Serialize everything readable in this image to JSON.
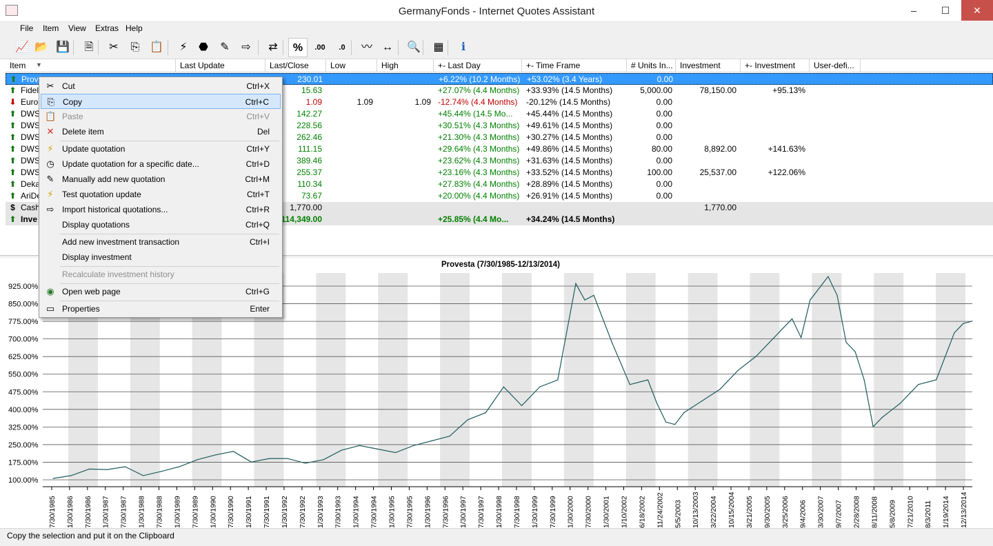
{
  "window": {
    "title": "GermanyFonds - Internet Quotes Assistant",
    "minimize": "–",
    "maximize": "☐",
    "close": "✕"
  },
  "menu": [
    "File",
    "Item",
    "View",
    "Extras",
    "Help"
  ],
  "toolbar": [
    {
      "name": "chart-icon",
      "glyph": "📈"
    },
    {
      "name": "open-folder-icon",
      "glyph": "📂"
    },
    {
      "name": "save-icon",
      "glyph": "💾"
    },
    {
      "name": "new-item-icon",
      "glyph": "🗎"
    },
    {
      "name": "cut-icon",
      "glyph": "✂"
    },
    {
      "name": "copy-icon",
      "glyph": "⎘"
    },
    {
      "name": "paste-icon",
      "glyph": "📋"
    },
    {
      "name": "update-icon",
      "glyph": "⚡"
    },
    {
      "name": "stop-icon",
      "glyph": "⬣"
    },
    {
      "name": "edit-icon",
      "glyph": "✎"
    },
    {
      "name": "import-icon",
      "glyph": "⇨"
    },
    {
      "name": "transfer-icon",
      "glyph": "⇄"
    },
    {
      "name": "percent-icon",
      "glyph": "%"
    },
    {
      "name": "more-decimals-icon",
      "glyph": ".00"
    },
    {
      "name": "less-decimals-icon",
      "glyph": ".0"
    },
    {
      "name": "compare-chart-icon",
      "glyph": "〰"
    },
    {
      "name": "timeframe-chart-icon",
      "glyph": "↔"
    },
    {
      "name": "search-icon",
      "glyph": "🔍"
    },
    {
      "name": "calculator-icon",
      "glyph": "▦"
    },
    {
      "name": "info-icon",
      "glyph": "ℹ"
    }
  ],
  "columns": [
    "Item",
    "Last Update",
    "Last/Close",
    "Low",
    "High",
    "+- Last Day",
    "+- Time Frame",
    "# Units In...",
    "Investment",
    "+- Investment",
    "User-defi..."
  ],
  "rows": [
    {
      "icon": "up",
      "item": "Prov",
      "update": "",
      "close": "230.01",
      "low": "",
      "high": "",
      "day": "+6.22% (10.2 Months)",
      "tf": "+53.02% (3.4 Years)",
      "units": "0.00",
      "inv": "",
      "invchg": "",
      "selected": true
    },
    {
      "icon": "up",
      "item": "Fidel",
      "update": "",
      "close": "15.63",
      "low": "",
      "high": "",
      "day": "+27.07% (4.4 Months)",
      "tf": "+33.93% (14.5 Months)",
      "units": "5,000.00",
      "inv": "78,150.00",
      "invchg": "+95.13%"
    },
    {
      "icon": "down",
      "item": "Euro",
      "update": "",
      "close": "1.09",
      "low": "1.09",
      "high": "1.09",
      "day": "-12.74% (4.4 Months)",
      "tf": "-20.12% (14.5 Months)",
      "units": "0.00",
      "inv": "",
      "invchg": ""
    },
    {
      "icon": "up",
      "item": "DWS",
      "update": "",
      "close": "142.27",
      "low": "",
      "high": "",
      "day": "+45.44% (14.5 Mo...",
      "tf": "+45.44% (14.5 Months)",
      "units": "0.00",
      "inv": "",
      "invchg": ""
    },
    {
      "icon": "up",
      "item": "DWS",
      "update": "",
      "close": "228.56",
      "low": "",
      "high": "",
      "day": "+30.51% (4.3 Months)",
      "tf": "+49.61% (14.5 Months)",
      "units": "0.00",
      "inv": "",
      "invchg": ""
    },
    {
      "icon": "up",
      "item": "DWS",
      "update": "",
      "close": "262.46",
      "low": "",
      "high": "",
      "day": "+21.30% (4.3 Months)",
      "tf": "+30.27% (14.5 Months)",
      "units": "0.00",
      "inv": "",
      "invchg": ""
    },
    {
      "icon": "up",
      "item": "DWS",
      "update": "",
      "close": "111.15",
      "low": "",
      "high": "",
      "day": "+29.64% (4.3 Months)",
      "tf": "+49.86% (14.5 Months)",
      "units": "80.00",
      "inv": "8,892.00",
      "invchg": "+141.63%"
    },
    {
      "icon": "up",
      "item": "DWS",
      "update": "",
      "close": "389.46",
      "low": "",
      "high": "",
      "day": "+23.62% (4.3 Months)",
      "tf": "+31.63% (14.5 Months)",
      "units": "0.00",
      "inv": "",
      "invchg": ""
    },
    {
      "icon": "up",
      "item": "DWS",
      "update": "",
      "close": "255.37",
      "low": "",
      "high": "",
      "day": "+23.16% (4.3 Months)",
      "tf": "+33.52% (14.5 Months)",
      "units": "100.00",
      "inv": "25,537.00",
      "invchg": "+122.06%"
    },
    {
      "icon": "up2",
      "item": "Deka",
      "update": "",
      "close": "110.34",
      "low": "",
      "high": "",
      "day": "+27.83% (4.4 Months)",
      "tf": "+28.89% (14.5 Months)",
      "units": "0.00",
      "inv": "",
      "invchg": ""
    },
    {
      "icon": "up2",
      "item": "AriDe",
      "update": "",
      "close": "73.67",
      "low": "",
      "high": "",
      "day": "+20.00% (4.4 Months)",
      "tf": "+26.91% (14.5 Months)",
      "units": "0.00",
      "inv": "",
      "invchg": ""
    },
    {
      "icon": "cash",
      "item": "Cash",
      "update": "",
      "close": "1,770.00",
      "low": "",
      "high": "",
      "day": "",
      "tf": "",
      "units": "",
      "inv": "1,770.00",
      "invchg": "",
      "gray": true
    },
    {
      "icon": "up",
      "item": "Inve",
      "update": "",
      "close": "114,349.00",
      "low": "",
      "high": "",
      "day": "+25.85% (4.4 Mo...",
      "tf": "+34.24% (14.5 Months)",
      "units": "",
      "inv": "",
      "invchg": "",
      "gray": true,
      "bold": true
    }
  ],
  "context_menu": [
    {
      "label": "Cut",
      "shortcut": "Ctrl+X",
      "icon": "cut-icon",
      "glyph": "✂"
    },
    {
      "label": "Copy",
      "shortcut": "Ctrl+C",
      "icon": "copy-icon",
      "glyph": "⎘",
      "highlight": true
    },
    {
      "label": "Paste",
      "shortcut": "Ctrl+V",
      "icon": "paste-icon",
      "glyph": "📋",
      "disabled": true
    },
    {
      "label": "Delete item",
      "shortcut": "Del",
      "icon": "delete-icon",
      "glyph": "✕"
    },
    {
      "sep": true
    },
    {
      "label": "Update quotation",
      "shortcut": "Ctrl+Y",
      "icon": "update-icon",
      "glyph": "⚡"
    },
    {
      "label": "Update quotation for a specific date...",
      "shortcut": "Ctrl+D",
      "icon": "clock-icon",
      "glyph": "◷"
    },
    {
      "label": "Manually add new quotation",
      "shortcut": "Ctrl+M",
      "icon": "edit-icon",
      "glyph": "✎"
    },
    {
      "label": "Test quotation update",
      "shortcut": "Ctrl+T",
      "icon": "test-icon",
      "glyph": "⚡"
    },
    {
      "label": "Import historical quotations...",
      "shortcut": "Ctrl+R",
      "icon": "import-icon",
      "glyph": "⇨"
    },
    {
      "label": "Display quotations",
      "shortcut": "Ctrl+Q",
      "icon": "",
      "glyph": ""
    },
    {
      "sep": true
    },
    {
      "label": "Add new investment transaction",
      "shortcut": "Ctrl+I",
      "icon": "",
      "glyph": ""
    },
    {
      "label": "Display investment",
      "shortcut": "",
      "icon": "",
      "glyph": ""
    },
    {
      "sep": true
    },
    {
      "label": "Recalculate investment history",
      "shortcut": "",
      "icon": "",
      "glyph": "",
      "disabled": true
    },
    {
      "sep": true
    },
    {
      "label": "Open web page",
      "shortcut": "Ctrl+G",
      "icon": "globe-icon",
      "glyph": "◉"
    },
    {
      "sep": true
    },
    {
      "label": "Properties",
      "shortcut": "Enter",
      "icon": "properties-icon",
      "glyph": "▭"
    }
  ],
  "status": "Copy the selection and put it on the Clipboard",
  "colors": {
    "line": "#1f5c5c",
    "band": "#e6e6e6",
    "selection": "#3399ff",
    "green": "#008000",
    "red": "#c00000"
  },
  "chart_data": {
    "type": "line",
    "title": "Provesta (7/30/1985-12/13/2014)",
    "yticks": [
      "100.00%",
      "175.00%",
      "250.00%",
      "325.00%",
      "400.00%",
      "475.00%",
      "550.00%",
      "625.00%",
      "700.00%",
      "775.00%",
      "850.00%",
      "925.00%"
    ],
    "ylim": [
      100,
      975
    ],
    "xticks": [
      "7/30/1985",
      "1/30/1986",
      "7/30/1986",
      "1/30/1987",
      "7/30/1987",
      "1/30/1988",
      "7/30/1988",
      "1/30/1989",
      "7/30/1989",
      "1/30/1990",
      "7/30/1990",
      "1/30/1991",
      "7/30/1991",
      "1/30/1992",
      "7/30/1992",
      "1/30/1993",
      "7/30/1993",
      "1/30/1994",
      "7/30/1994",
      "1/30/1995",
      "7/30/1995",
      "1/30/1996",
      "7/30/1996",
      "1/30/1997",
      "7/30/1997",
      "1/30/1998",
      "7/30/1998",
      "1/30/1999",
      "7/30/1999",
      "1/30/2000",
      "7/30/2000",
      "1/30/2001",
      "1/10/2002",
      "6/18/2002",
      "11/24/2002",
      "5/5/2003",
      "10/13/2003",
      "3/22/2004",
      "10/15/2004",
      "3/21/2005",
      "9/30/2005",
      "3/25/2006",
      "9/4/2006",
      "3/30/2007",
      "9/7/2007",
      "2/28/2008",
      "8/11/2008",
      "5/8/2009",
      "7/21/2010",
      "8/3/2011",
      "1/19/2014",
      "12/13/2014"
    ],
    "x": [
      0,
      1,
      2,
      3,
      4,
      5,
      6,
      7,
      8,
      9,
      10,
      11,
      12,
      13,
      14,
      15,
      16,
      17,
      18,
      19,
      20,
      21,
      22,
      23,
      24,
      25,
      26,
      27,
      28,
      29,
      29.5,
      30,
      31,
      32,
      33,
      33.5,
      34,
      34.5,
      35,
      36,
      37,
      38,
      39,
      40,
      41,
      41.5,
      42,
      43,
      43.5,
      44,
      44.5,
      45,
      45.5,
      46,
      46.5,
      47,
      48,
      49,
      50,
      50.5,
      51
    ],
    "values": [
      100,
      112,
      140,
      138,
      150,
      112,
      130,
      150,
      180,
      200,
      215,
      170,
      185,
      185,
      165,
      180,
      220,
      240,
      225,
      210,
      240,
      260,
      280,
      350,
      380,
      490,
      410,
      490,
      520,
      930,
      860,
      880,
      680,
      500,
      520,
      420,
      340,
      330,
      380,
      430,
      480,
      560,
      620,
      700,
      780,
      700,
      860,
      960,
      880,
      680,
      640,
      520,
      320,
      360,
      390,
      420,
      500,
      520,
      720,
      760,
      770
    ]
  }
}
